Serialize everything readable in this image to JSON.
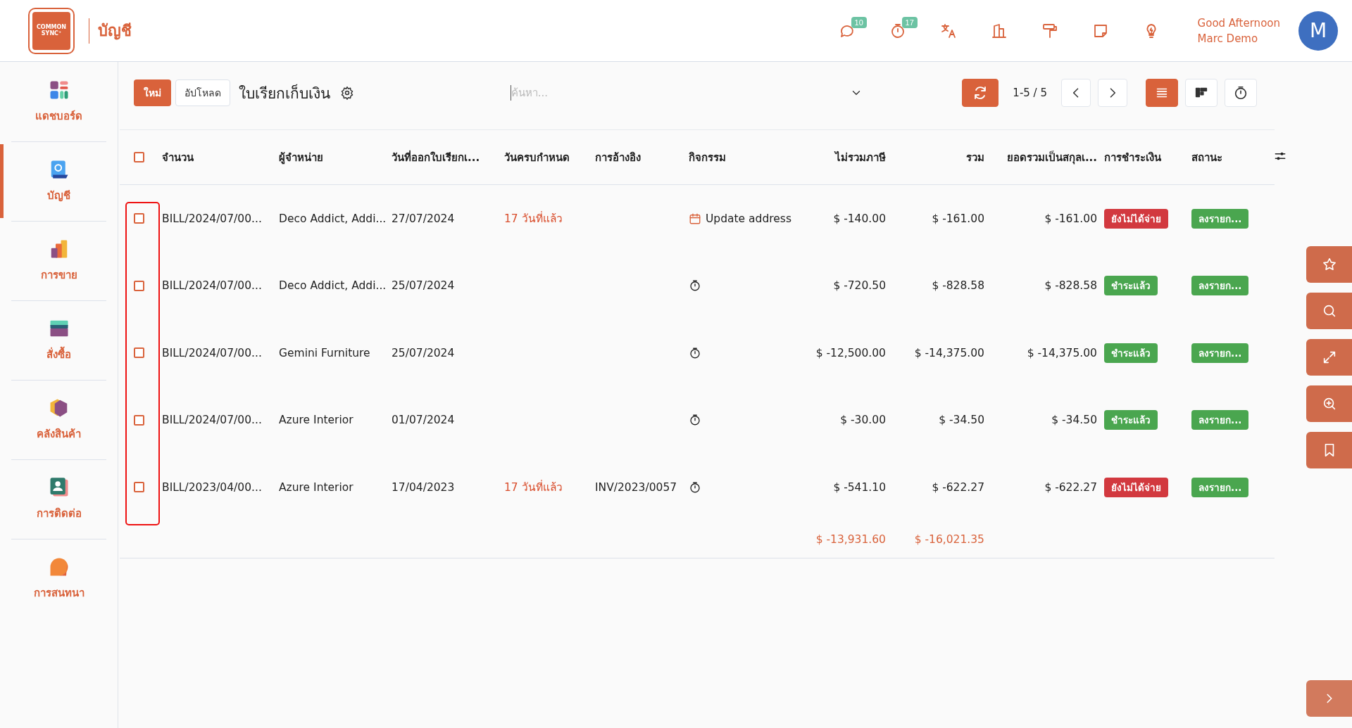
{
  "header": {
    "app_name": "บัญชี",
    "logo_text": "COMMON SYNC⁺",
    "tools": [
      {
        "kind": "chat",
        "badge": "10"
      },
      {
        "kind": "timer",
        "badge": "17"
      },
      {
        "kind": "translate"
      },
      {
        "kind": "company"
      },
      {
        "kind": "roller"
      },
      {
        "kind": "note"
      },
      {
        "kind": "idea"
      }
    ],
    "greeting": "Good Afternoon",
    "user": "Marc Demo",
    "avatar": "M"
  },
  "sidebar": {
    "items": [
      {
        "kind": "dashboard",
        "label": "แดชบอร์ด",
        "selected": false
      },
      {
        "kind": "accounting",
        "label": "บัญชี",
        "selected": true
      },
      {
        "kind": "sales",
        "label": "การขาย",
        "selected": false
      },
      {
        "kind": "purchase",
        "label": "สั่งซื้อ",
        "selected": false
      },
      {
        "kind": "inventory",
        "label": "คลังสินค้า",
        "selected": false
      },
      {
        "kind": "contacts",
        "label": "การติดต่อ",
        "selected": false
      },
      {
        "kind": "chat",
        "label": "การสนทนา",
        "selected": false
      }
    ]
  },
  "toolbar": {
    "new_button": "ใหม่",
    "upload_button": "อัปโหลด",
    "title": "ใบเรียกเก็บเงิน",
    "search": {
      "placeholder": "ค้นหา..."
    },
    "pager": "1-5 / 5",
    "views": [
      {
        "kind": "list",
        "selected": true
      },
      {
        "kind": "kanban",
        "selected": false
      },
      {
        "kind": "activity",
        "selected": false
      }
    ]
  },
  "table": {
    "select_all_checked": false,
    "checkbox_column_highlighted": true,
    "columns": [
      "จำนวน",
      "ผู้จำหน่าย",
      "วันที่ออกใบเรียกเ...",
      "วันครบกำหนด",
      "การอ้างอิง",
      "กิจกรรม",
      "ไม่รวมภาษี",
      "รวม",
      "ยอดรวมเป็นสกุลเ...",
      "การชำระเงิน",
      "สถานะ"
    ],
    "rows": [
      {
        "checked": false,
        "number": "BILL/2024/07/00...",
        "vendor": "Deco Addict, Addi...",
        "invoice_date": "27/07/2024",
        "due": "17 วันที่แล้ว",
        "reference": "",
        "activity": {
          "kind": "todo",
          "label": "Update address"
        },
        "untaxed": "$ -140.00",
        "total": "$ -161.00",
        "total_currency": "$ -161.00",
        "payment": {
          "kind": "unpaid",
          "label": "ยังไม่ได้จ่าย"
        },
        "status": "ลงรายก..."
      },
      {
        "checked": false,
        "number": "BILL/2024/07/00...",
        "vendor": "Deco Addict, Addi...",
        "invoice_date": "25/07/2024",
        "due": "",
        "reference": "",
        "activity": {
          "kind": "none"
        },
        "untaxed": "$ -720.50",
        "total": "$ -828.58",
        "total_currency": "$ -828.58",
        "payment": {
          "kind": "paid",
          "label": "ชำระแล้ว"
        },
        "status": "ลงรายก..."
      },
      {
        "checked": false,
        "number": "BILL/2024/07/00...",
        "vendor": "Gemini Furniture",
        "invoice_date": "25/07/2024",
        "due": "",
        "reference": "",
        "activity": {
          "kind": "none"
        },
        "untaxed": "$ -12,500.00",
        "total": "$ -14,375.00",
        "total_currency": "$ -14,375.00",
        "payment": {
          "kind": "paid",
          "label": "ชำระแล้ว"
        },
        "status": "ลงรายก..."
      },
      {
        "checked": false,
        "number": "BILL/2024/07/00...",
        "vendor": "Azure Interior",
        "invoice_date": "01/07/2024",
        "due": "",
        "reference": "",
        "activity": {
          "kind": "none"
        },
        "untaxed": "$ -30.00",
        "total": "$ -34.50",
        "total_currency": "$ -34.50",
        "payment": {
          "kind": "paid",
          "label": "ชำระแล้ว"
        },
        "status": "ลงรายก..."
      },
      {
        "checked": false,
        "number": "BILL/2023/04/00...",
        "vendor": "Azure Interior",
        "invoice_date": "17/04/2023",
        "due": "17 วันที่แล้ว",
        "reference": "INV/2023/0057",
        "activity": {
          "kind": "none"
        },
        "untaxed": "$ -541.10",
        "total": "$ -622.27",
        "total_currency": "$ -622.27",
        "payment": {
          "kind": "unpaid",
          "label": "ยังไม่ได้จ่าย"
        },
        "status": "ลงรายก..."
      }
    ],
    "totals": {
      "untaxed": "$ -13,931.60",
      "total": "$ -16,021.35"
    }
  },
  "side_actions": [
    {
      "kind": "favorite"
    },
    {
      "kind": "search"
    },
    {
      "kind": "expand"
    },
    {
      "kind": "zoom"
    },
    {
      "kind": "bookmark"
    },
    {
      "kind": "next"
    }
  ]
}
